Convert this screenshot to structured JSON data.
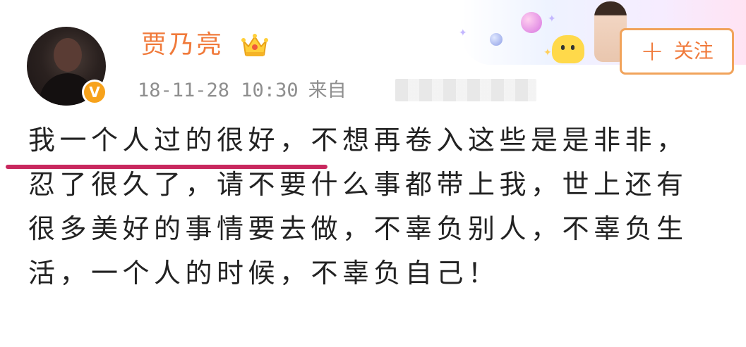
{
  "author": {
    "name": "贾乃亮",
    "verified_badge": "V"
  },
  "post": {
    "time": "18-11-28 10:30",
    "source_label": "来自",
    "lines": [
      "我一个人过的很好，不想再卷入这些是是非非，",
      "忍了很久了，请不要什么事都带上我，世上还有",
      "很多美好的事情要去做，不辜负别人，不辜负生",
      "活，一个人的时候，不辜负自己！"
    ]
  },
  "follow_button": {
    "icon": "+",
    "label": "关注"
  },
  "colors": {
    "accent": "#f07a3b",
    "underline": "#c8285e",
    "badge": "#f7a21b"
  }
}
